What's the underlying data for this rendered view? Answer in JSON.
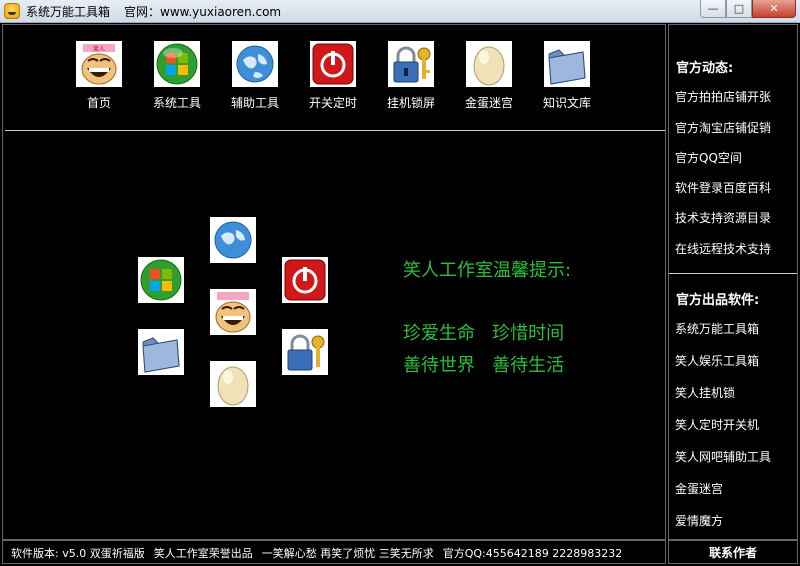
{
  "window": {
    "title": "系统万能工具箱",
    "site_label": "官网：www.yuxiaoren.com",
    "min_glyph": "—",
    "max_glyph": "□",
    "close_glyph": "✕"
  },
  "toolbar": {
    "items": [
      {
        "label": "首页",
        "icon": "smiley-face-icon"
      },
      {
        "label": "系统工具",
        "icon": "windows-logo-icon"
      },
      {
        "label": "辅助工具",
        "icon": "globe-icon"
      },
      {
        "label": "开关定时",
        "icon": "power-button-icon"
      },
      {
        "label": "挂机锁屏",
        "icon": "padlock-key-icon"
      },
      {
        "label": "金蛋迷宫",
        "icon": "golden-egg-icon"
      },
      {
        "label": "知识文库",
        "icon": "folder-icon"
      }
    ]
  },
  "tips": {
    "title": "笑人工作室温馨提示:",
    "line1": "珍爱生命   珍惜时间",
    "line2": "善待世界   善待生活"
  },
  "sidebar": {
    "news_title": "官方动态:",
    "news": [
      "官方拍拍店铺开张",
      "官方淘宝店铺促销",
      "官方QQ空间",
      "软件登录百度百科",
      "技术支持资源目录",
      "在线远程技术支持"
    ],
    "software_title": "官方出品软件:",
    "software": [
      "系统万能工具箱",
      "笑人娱乐工具箱",
      "笑人挂机锁",
      "笑人定时开关机",
      "笑人网吧辅助工具",
      "金蛋迷宫",
      "爱情魔方"
    ]
  },
  "status": {
    "version": "软件版本: v5.0 双蛋祈福版",
    "studio": "笑人工作室荣誉出品",
    "slogan": "一笑解心愁 再笑了烦忧 三笑无所求",
    "qq": "官方QQ:455642189 2228983232"
  },
  "contact_label": "联系作者",
  "colors": {
    "tip_green": "#2bbf3a",
    "background": "#000000",
    "close_red": "#c4432c"
  }
}
